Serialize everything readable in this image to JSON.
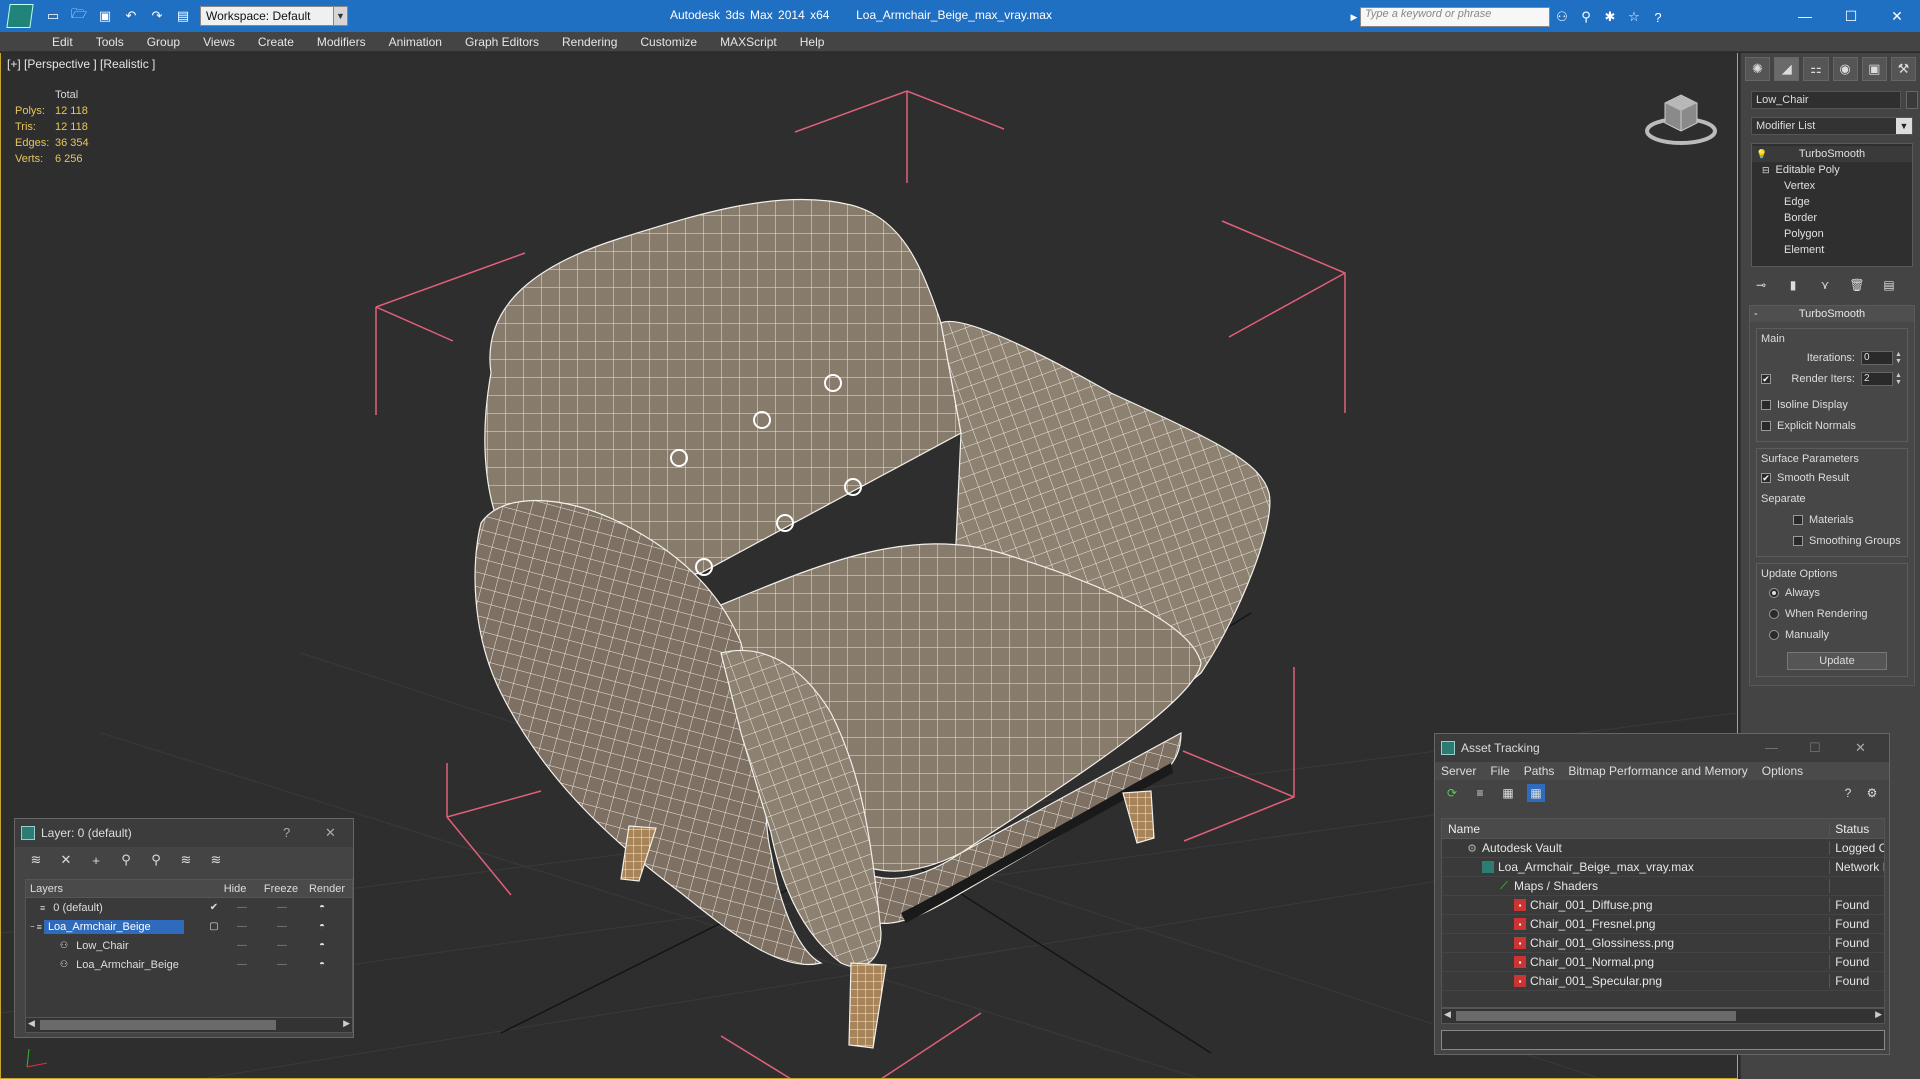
{
  "window": {
    "app_title": "Autodesk 3ds Max  2014 x64",
    "file_title": "Loa_Armchair_Beige_max_vray.max",
    "workspace_label": "Workspace: Default",
    "search_placeholder": "Type a keyword or phrase"
  },
  "menu": [
    "Edit",
    "Tools",
    "Group",
    "Views",
    "Create",
    "Modifiers",
    "Animation",
    "Graph Editors",
    "Rendering",
    "Customize",
    "MAXScript",
    "Help"
  ],
  "viewport": {
    "label": "[+] [Perspective ] [Realistic ]",
    "stats_header": "Total",
    "stats": [
      {
        "label": "Polys:",
        "value": "12 118"
      },
      {
        "label": "Tris:",
        "value": "12 118"
      },
      {
        "label": "Edges:",
        "value": "36 354"
      },
      {
        "label": "Verts:",
        "value": "6 256"
      }
    ]
  },
  "command_panel": {
    "object_name": "Low_Chair",
    "modifier_list_label": "Modifier List",
    "stack": {
      "top": "TurboSmooth",
      "base": "Editable Poly",
      "sub": [
        "Vertex",
        "Edge",
        "Border",
        "Polygon",
        "Element"
      ]
    },
    "turbosmooth": {
      "title": "TurboSmooth",
      "main_label": "Main",
      "iterations_label": "Iterations:",
      "iterations_value": "0",
      "render_iters_label": "Render Iters:",
      "render_iters_value": "2",
      "render_iters_checked": true,
      "isoline_label": "Isoline Display",
      "explicit_normals_label": "Explicit Normals",
      "surface_params_label": "Surface Parameters",
      "smooth_result_label": "Smooth Result",
      "smooth_result_checked": true,
      "separate_label": "Separate",
      "materials_label": "Materials",
      "smoothing_groups_label": "Smoothing Groups",
      "update_options_label": "Update Options",
      "always_label": "Always",
      "when_rendering_label": "When Rendering",
      "manually_label": "Manually",
      "update_button": "Update"
    }
  },
  "layer_dialog": {
    "title": "Layer: 0 (default)",
    "help": "?",
    "columns": {
      "layers": "Layers",
      "hide": "Hide",
      "freeze": "Freeze",
      "render": "Render"
    },
    "rows": [
      {
        "name": "0 (default)",
        "mark": "✔",
        "selected": false,
        "indent": 1
      },
      {
        "name": "Loa_Armchair_Beige",
        "mark": "▢",
        "selected": true,
        "indent": 1
      },
      {
        "name": "Low_Chair",
        "mark": "",
        "selected": false,
        "indent": 2
      },
      {
        "name": "Loa_Armchair_Beige",
        "mark": "",
        "selected": false,
        "indent": 2
      }
    ]
  },
  "asset_dialog": {
    "title": "Asset Tracking",
    "menu": [
      "Server",
      "File",
      "Paths",
      "Bitmap Performance and Memory",
      "Options"
    ],
    "columns": {
      "name": "Name",
      "status": "Status"
    },
    "rows": [
      {
        "name": "Autodesk Vault",
        "status": "Logged C",
        "icon": "vault",
        "indent": 1
      },
      {
        "name": "Loa_Armchair_Beige_max_vray.max",
        "status": "Network I",
        "icon": "max",
        "indent": 2
      },
      {
        "name": "Maps / Shaders",
        "status": "",
        "icon": "maps",
        "indent": 3
      },
      {
        "name": "Chair_001_Diffuse.png",
        "status": "Found",
        "icon": "png",
        "indent": 4
      },
      {
        "name": "Chair_001_Fresnel.png",
        "status": "Found",
        "icon": "png",
        "indent": 4
      },
      {
        "name": "Chair_001_Glossiness.png",
        "status": "Found",
        "icon": "png",
        "indent": 4
      },
      {
        "name": "Chair_001_Normal.png",
        "status": "Found",
        "icon": "png",
        "indent": 4
      },
      {
        "name": "Chair_001_Specular.png",
        "status": "Found",
        "icon": "png",
        "indent": 4
      }
    ]
  },
  "colors": {
    "title_bar": "#1f6fc2",
    "selection": "#2f6bbd",
    "stats_text": "#e6c65c",
    "viewport_border": "#c9a62a",
    "bbox": "#e0607a"
  }
}
